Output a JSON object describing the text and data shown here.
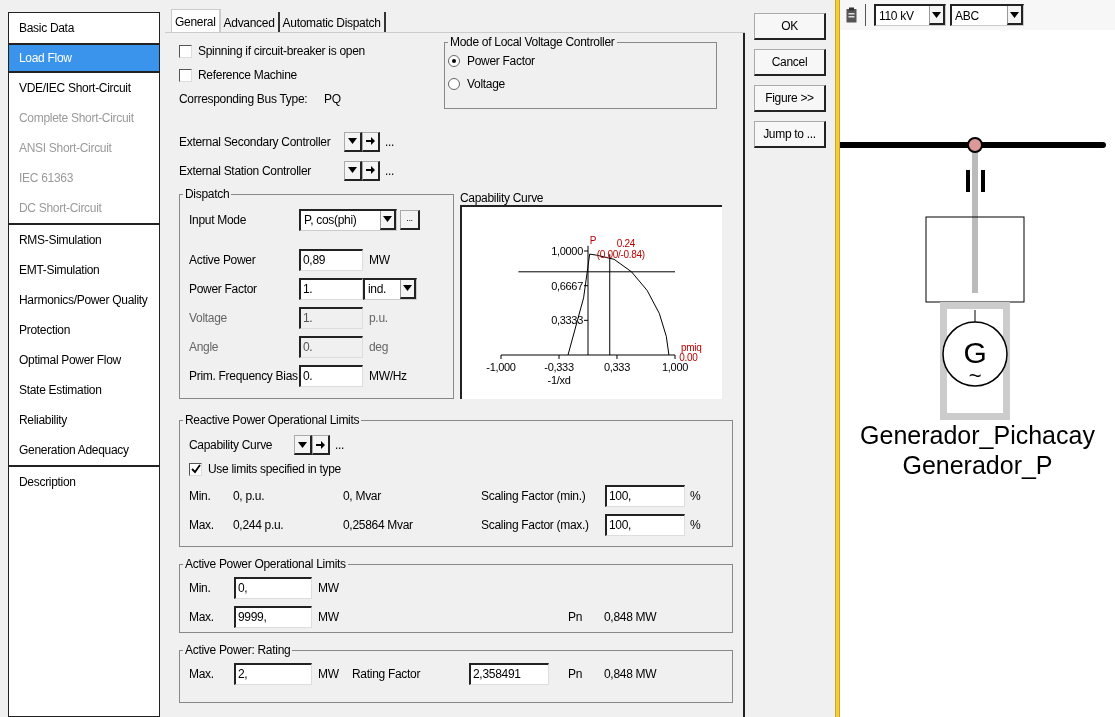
{
  "sidebar": {
    "groups": [
      [
        {
          "label": "Basic Data",
          "selected": false,
          "disabled": false
        },
        {
          "label": "Load Flow",
          "selected": true,
          "disabled": false
        },
        {
          "label": "VDE/IEC Short-Circuit",
          "selected": false,
          "disabled": false
        },
        {
          "label": "Complete Short-Circuit",
          "selected": false,
          "disabled": true
        },
        {
          "label": "ANSI Short-Circuit",
          "selected": false,
          "disabled": true
        },
        {
          "label": "IEC 61363",
          "selected": false,
          "disabled": true
        },
        {
          "label": "DC Short-Circuit",
          "selected": false,
          "disabled": true
        }
      ],
      [
        {
          "label": "RMS-Simulation",
          "selected": false,
          "disabled": false
        },
        {
          "label": "EMT-Simulation",
          "selected": false,
          "disabled": false
        },
        {
          "label": "Harmonics/Power Quality",
          "selected": false,
          "disabled": false
        },
        {
          "label": "Protection",
          "selected": false,
          "disabled": false
        },
        {
          "label": "Optimal Power Flow",
          "selected": false,
          "disabled": false
        },
        {
          "label": "State Estimation",
          "selected": false,
          "disabled": false
        },
        {
          "label": "Reliability",
          "selected": false,
          "disabled": false
        },
        {
          "label": "Generation Adequacy",
          "selected": false,
          "disabled": false
        }
      ],
      [
        {
          "label": "Description",
          "selected": false,
          "disabled": false
        }
      ]
    ]
  },
  "tabs": [
    {
      "label": "General",
      "selected": true
    },
    {
      "label": "Advanced",
      "selected": false
    },
    {
      "label": "Automatic Dispatch",
      "selected": false
    }
  ],
  "options": [
    {
      "label": "Spinning if circuit-breaker is open",
      "checked": false
    },
    {
      "label": "Reference Machine",
      "checked": false
    }
  ],
  "bus_type": {
    "label": "Corresponding Bus Type:",
    "value": "PQ"
  },
  "voltage_controller": {
    "title": "Mode of Local Voltage Controller",
    "options": [
      {
        "label": "Power Factor",
        "selected": true
      },
      {
        "label": "Voltage",
        "selected": false
      }
    ]
  },
  "controllers": [
    {
      "label": "External Secondary Controller",
      "more": "..."
    },
    {
      "label": "External Station Controller",
      "more": "..."
    }
  ],
  "dispatch": {
    "title": "Dispatch",
    "rows": [
      {
        "kind": "select",
        "label": "Input Mode",
        "value": "P, cos(phi)",
        "more": "..."
      },
      {
        "kind": "input",
        "label": "Active Power",
        "value": "0,89",
        "unit": "MW",
        "disabled": false
      },
      {
        "kind": "input_select",
        "label": "Power Factor",
        "value": "1.",
        "option": "ind.",
        "disabled": false
      },
      {
        "kind": "input",
        "label": "Voltage",
        "value": "1.",
        "unit": "p.u.",
        "disabled": true
      },
      {
        "kind": "input",
        "label": "Angle",
        "value": "0.",
        "unit": "deg",
        "disabled": true
      },
      {
        "kind": "input",
        "label": "Prim. Frequency Bias",
        "value": "0.",
        "unit": "MW/Hz",
        "disabled": false
      }
    ]
  },
  "capability": {
    "title": "Capability Curve",
    "chart_data": {
      "type": "line",
      "xlabel": "-1/xd",
      "xlim": [
        -1,
        1
      ],
      "ylim": [
        0,
        1.05
      ],
      "xticks": [
        {
          "value": -1,
          "label": "-1,000"
        },
        {
          "value": -0.333,
          "label": "-0,333"
        },
        {
          "value": 0.333,
          "label": "0,333"
        },
        {
          "value": 1,
          "label": "1,000"
        }
      ],
      "yticks": [
        {
          "value": 0.3333,
          "label": "0,3333"
        },
        {
          "value": 0.6667,
          "label": "0,6667"
        },
        {
          "value": 1,
          "label": "1,0000"
        }
      ],
      "series": [
        {
          "color": "#000000",
          "x": [
            -0.23,
            -0.05,
            0.02,
            0.1,
            0.3,
            0.5,
            0.68,
            0.82,
            0.9,
            0.93
          ],
          "values": [
            0,
            0.55,
            0.97,
            0.96,
            0.92,
            0.8,
            0.62,
            0.4,
            0.18,
            0
          ]
        }
      ],
      "annotations": [
        "P",
        "0.24",
        "(0.00/-0.84)",
        "pmiq",
        "0.00"
      ]
    }
  },
  "reactive_limits": {
    "title": "Reactive Power Operational Limits",
    "curve_label": "Capability Curve",
    "more": "...",
    "use_type": {
      "label": "Use limits specified in type",
      "checked": true
    },
    "rows": [
      {
        "label": "Min.",
        "pu": "0, p.u.",
        "mvar": "0, Mvar",
        "scaling_label": "Scaling Factor (min.)",
        "scaling": "100,",
        "unit": "%"
      },
      {
        "label": "Max.",
        "pu": "0,244 p.u.",
        "mvar": "0,25864 Mvar",
        "scaling_label": "Scaling Factor (max.)",
        "scaling": "100,",
        "unit": "%"
      }
    ]
  },
  "active_limits": {
    "title": "Active Power Operational Limits",
    "rows": [
      {
        "label": "Min.",
        "value": "0,",
        "unit": "MW"
      },
      {
        "label": "Max.",
        "value": "9999,",
        "unit": "MW",
        "pn_label": "Pn",
        "pn": "0,848 MW"
      }
    ]
  },
  "rating": {
    "title": "Active Power: Rating",
    "label": "Max.",
    "value": "2,",
    "unit": "MW",
    "factor_label": "Rating Factor",
    "factor": "2,358491",
    "pn_label": "Pn",
    "pn": "0,848 MW"
  },
  "buttons": [
    "OK",
    "Cancel",
    "Figure >>",
    "Jump to ..."
  ],
  "diagram": {
    "voltage": "110 kV",
    "phase": "ABC",
    "symbol": "G",
    "symbol_sub": "~",
    "labels": [
      "Generador_Pichacay",
      "Generador_P"
    ]
  }
}
